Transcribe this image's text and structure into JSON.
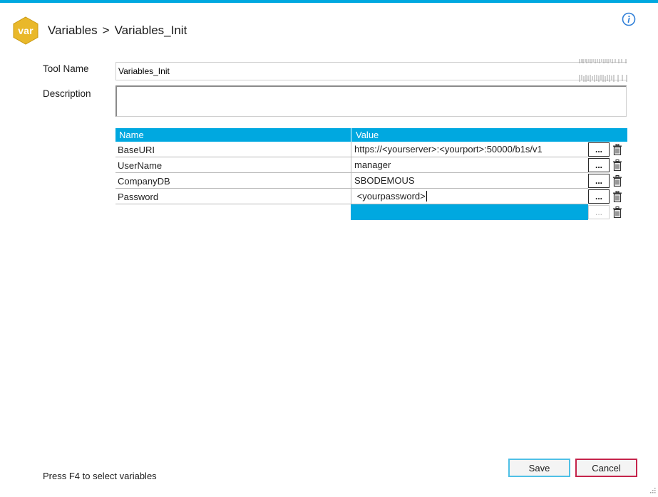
{
  "header": {
    "logo_text": "var",
    "breadcrumb": [
      "Variables",
      "Variables_Init"
    ],
    "separator": ">"
  },
  "form": {
    "tool_name_label": "Tool Name",
    "tool_name_value": "Variables_Init",
    "description_label": "Description",
    "description_value": ""
  },
  "grid": {
    "columns": [
      "Name",
      "Value"
    ],
    "rows": [
      {
        "name": "BaseURI",
        "value": "https://<yourserver>:<yourport>:50000/b1s/v1"
      },
      {
        "name": "UserName",
        "value": "manager"
      },
      {
        "name": "CompanyDB",
        "value": "SBODEMOUS"
      },
      {
        "name": "Password",
        "value": " <yourpassword>"
      }
    ],
    "ellipsis_label": "...",
    "accent_color": "#00a8e0"
  },
  "footer": {
    "hint": "Press F4 to select variables",
    "save_label": "Save",
    "cancel_label": "Cancel"
  },
  "icons": {
    "info": "info-icon",
    "delete": "trash-icon",
    "logo": "variables-hexagon-icon"
  }
}
